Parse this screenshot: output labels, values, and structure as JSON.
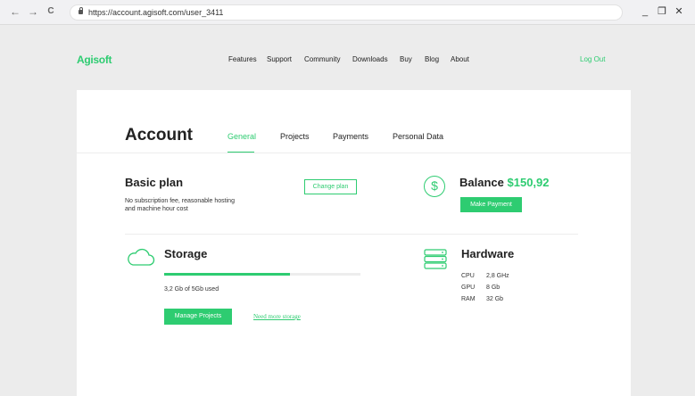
{
  "browser": {
    "url": "https://account.agisoft.com/user_3411",
    "back_glyph": "←",
    "forward_glyph": "→",
    "reload_glyph": "C",
    "minimize_glyph": "_",
    "restore_glyph": "❐",
    "close_glyph": "✕"
  },
  "header": {
    "brand": "Agisoft",
    "nav": [
      "Features",
      "Support",
      "Community",
      "Downloads",
      "Buy",
      "Blog",
      "About"
    ],
    "logout": "Log Out"
  },
  "account": {
    "title": "Account",
    "tabs": [
      "General",
      "Projects",
      "Payments",
      "Personal Data"
    ],
    "active_tab": "General"
  },
  "plan": {
    "title": "Basic plan",
    "desc_line1": "No subscription fee, reasonable hosting",
    "desc_line2": "and machine hour cost",
    "change_button": "Change plan"
  },
  "balance": {
    "label": "Balance",
    "amount": "$150,92",
    "icon_glyph": "$",
    "button": "Make Payment"
  },
  "storage": {
    "title": "Storage",
    "used_text": "3,2 Gb of 5Gb used",
    "fraction_used": 0.64,
    "manage_button": "Manage Projects",
    "more_link": "Need more storage"
  },
  "hardware": {
    "title": "Hardware",
    "specs": [
      {
        "key": "CPU",
        "value": "2,8 GHz"
      },
      {
        "key": "GPU",
        "value": "8 Gb"
      },
      {
        "key": "RAM",
        "value": "32 Gb"
      }
    ]
  },
  "colors": {
    "accent": "#2ecc71",
    "background": "#ececec",
    "card": "#ffffff"
  },
  "icons": [
    "back-icon",
    "forward-icon",
    "reload-icon",
    "lock-icon",
    "minimize-icon",
    "restore-icon",
    "close-icon",
    "dollar-icon",
    "cloud-icon",
    "server-icon"
  ]
}
